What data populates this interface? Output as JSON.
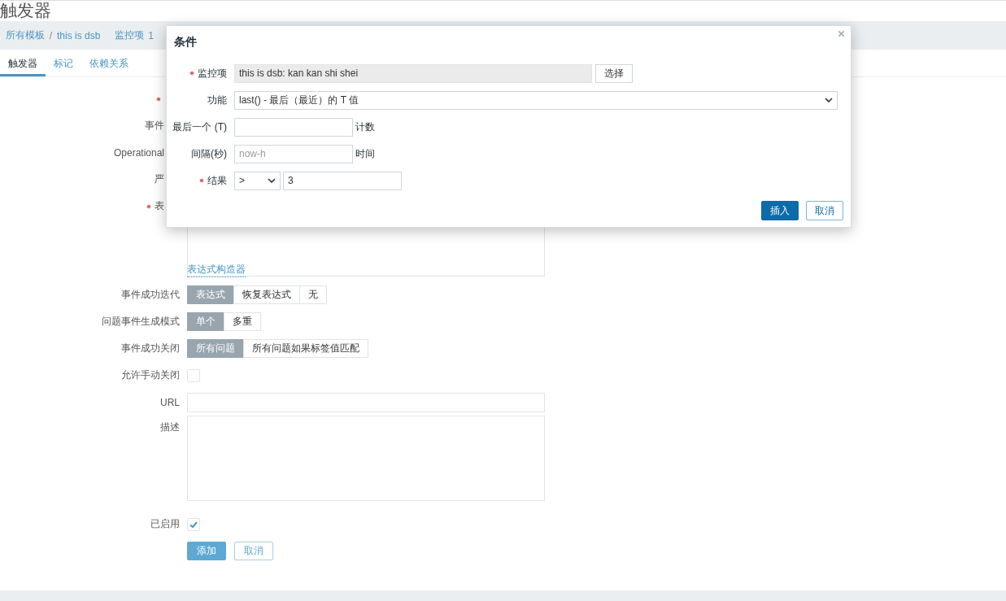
{
  "page": {
    "title": "触发器"
  },
  "breadcrumbs": [
    {
      "label": "所有模板"
    },
    {
      "label": "this is dsb"
    },
    {
      "label": "监控项",
      "count": "1"
    }
  ],
  "tabs": [
    {
      "label": "触发器",
      "selected": true
    },
    {
      "label": "标记",
      "selected": false
    },
    {
      "label": "依赖关系",
      "selected": false
    }
  ],
  "form": {
    "covered_labels": [
      {
        "required": true
      },
      {
        "label": "事件",
        "required": false
      },
      {
        "label": "Operational",
        "required": false
      },
      {
        "label": "严",
        "required": false
      },
      {
        "label": "表",
        "required": true
      }
    ],
    "expression_builder_link": "表达式构造器",
    "option_groups": [
      {
        "label": "事件成功迭代",
        "options": [
          {
            "label": "表达式",
            "selected": true
          },
          {
            "label": "恢复表达式",
            "selected": false
          },
          {
            "label": "无",
            "selected": false
          }
        ]
      },
      {
        "label": "问题事件生成模式",
        "options": [
          {
            "label": "单个",
            "selected": true
          },
          {
            "label": "多重",
            "selected": false
          }
        ]
      },
      {
        "label": "事件成功关闭",
        "options": [
          {
            "label": "所有问题",
            "selected": true
          },
          {
            "label": "所有问题如果标签值匹配",
            "selected": false
          }
        ]
      }
    ],
    "manual_close": {
      "label": "允许手动关闭",
      "checked": false
    },
    "url": {
      "label": "URL"
    },
    "description": {
      "label": "描述"
    },
    "enabled": {
      "label": "已启用",
      "checked": true
    },
    "buttons": [
      {
        "label": "添加",
        "kind": "primary"
      },
      {
        "label": "取消",
        "kind": "secondary"
      }
    ]
  },
  "dialog": {
    "title": "条件",
    "fields": [
      {
        "kind": "item",
        "label": "监控项",
        "required": true,
        "value": "this is  dsb: kan kan shi shei",
        "button": "选择"
      },
      {
        "kind": "select",
        "label": "功能",
        "required": false,
        "value": "last() - 最后（最近）的 T 值"
      },
      {
        "kind": "input",
        "label": "最后一个 (T)",
        "required": false,
        "suffix": "计数"
      },
      {
        "kind": "input",
        "label": "间隔(秒)",
        "required": false,
        "placeholder": "now-h",
        "suffix": "时间"
      },
      {
        "kind": "result",
        "label": "结果",
        "required": true,
        "operator": ">",
        "value": "3"
      }
    ],
    "buttons": [
      {
        "label": "插入",
        "kind": "primary"
      },
      {
        "label": "取消",
        "kind": "secondary"
      }
    ]
  }
}
